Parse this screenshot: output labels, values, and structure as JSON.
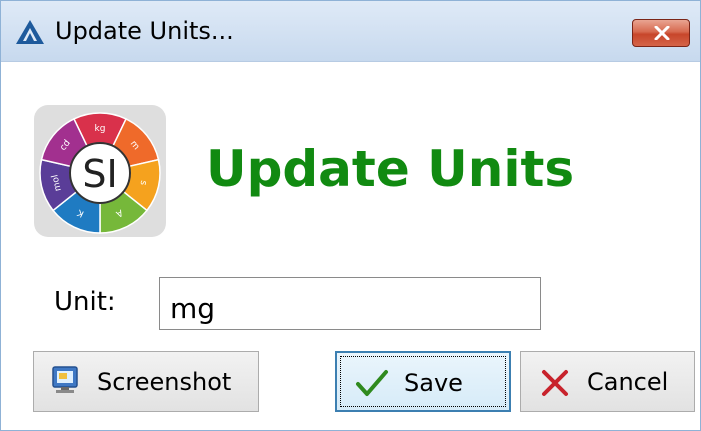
{
  "window": {
    "title": "Update Units...",
    "close_icon": "close-icon",
    "app_icon": "triangle-logo-icon"
  },
  "logo": {
    "center_text": "SI",
    "segment_labels": [
      "kg",
      "m",
      "s",
      "A",
      "K",
      "mol",
      "cd"
    ],
    "segment_colors": [
      "#d9314b",
      "#ef6a2a",
      "#f5a21e",
      "#76b83a",
      "#1f7bc2",
      "#5a3d98",
      "#a2308f"
    ]
  },
  "heading": "Update Units",
  "form": {
    "unit_label": "Unit:",
    "unit_value": "mg"
  },
  "buttons": {
    "screenshot": "Screenshot",
    "save": "Save",
    "cancel": "Cancel"
  },
  "colors": {
    "heading": "#118a11",
    "save_border": "#3c7fb1"
  }
}
